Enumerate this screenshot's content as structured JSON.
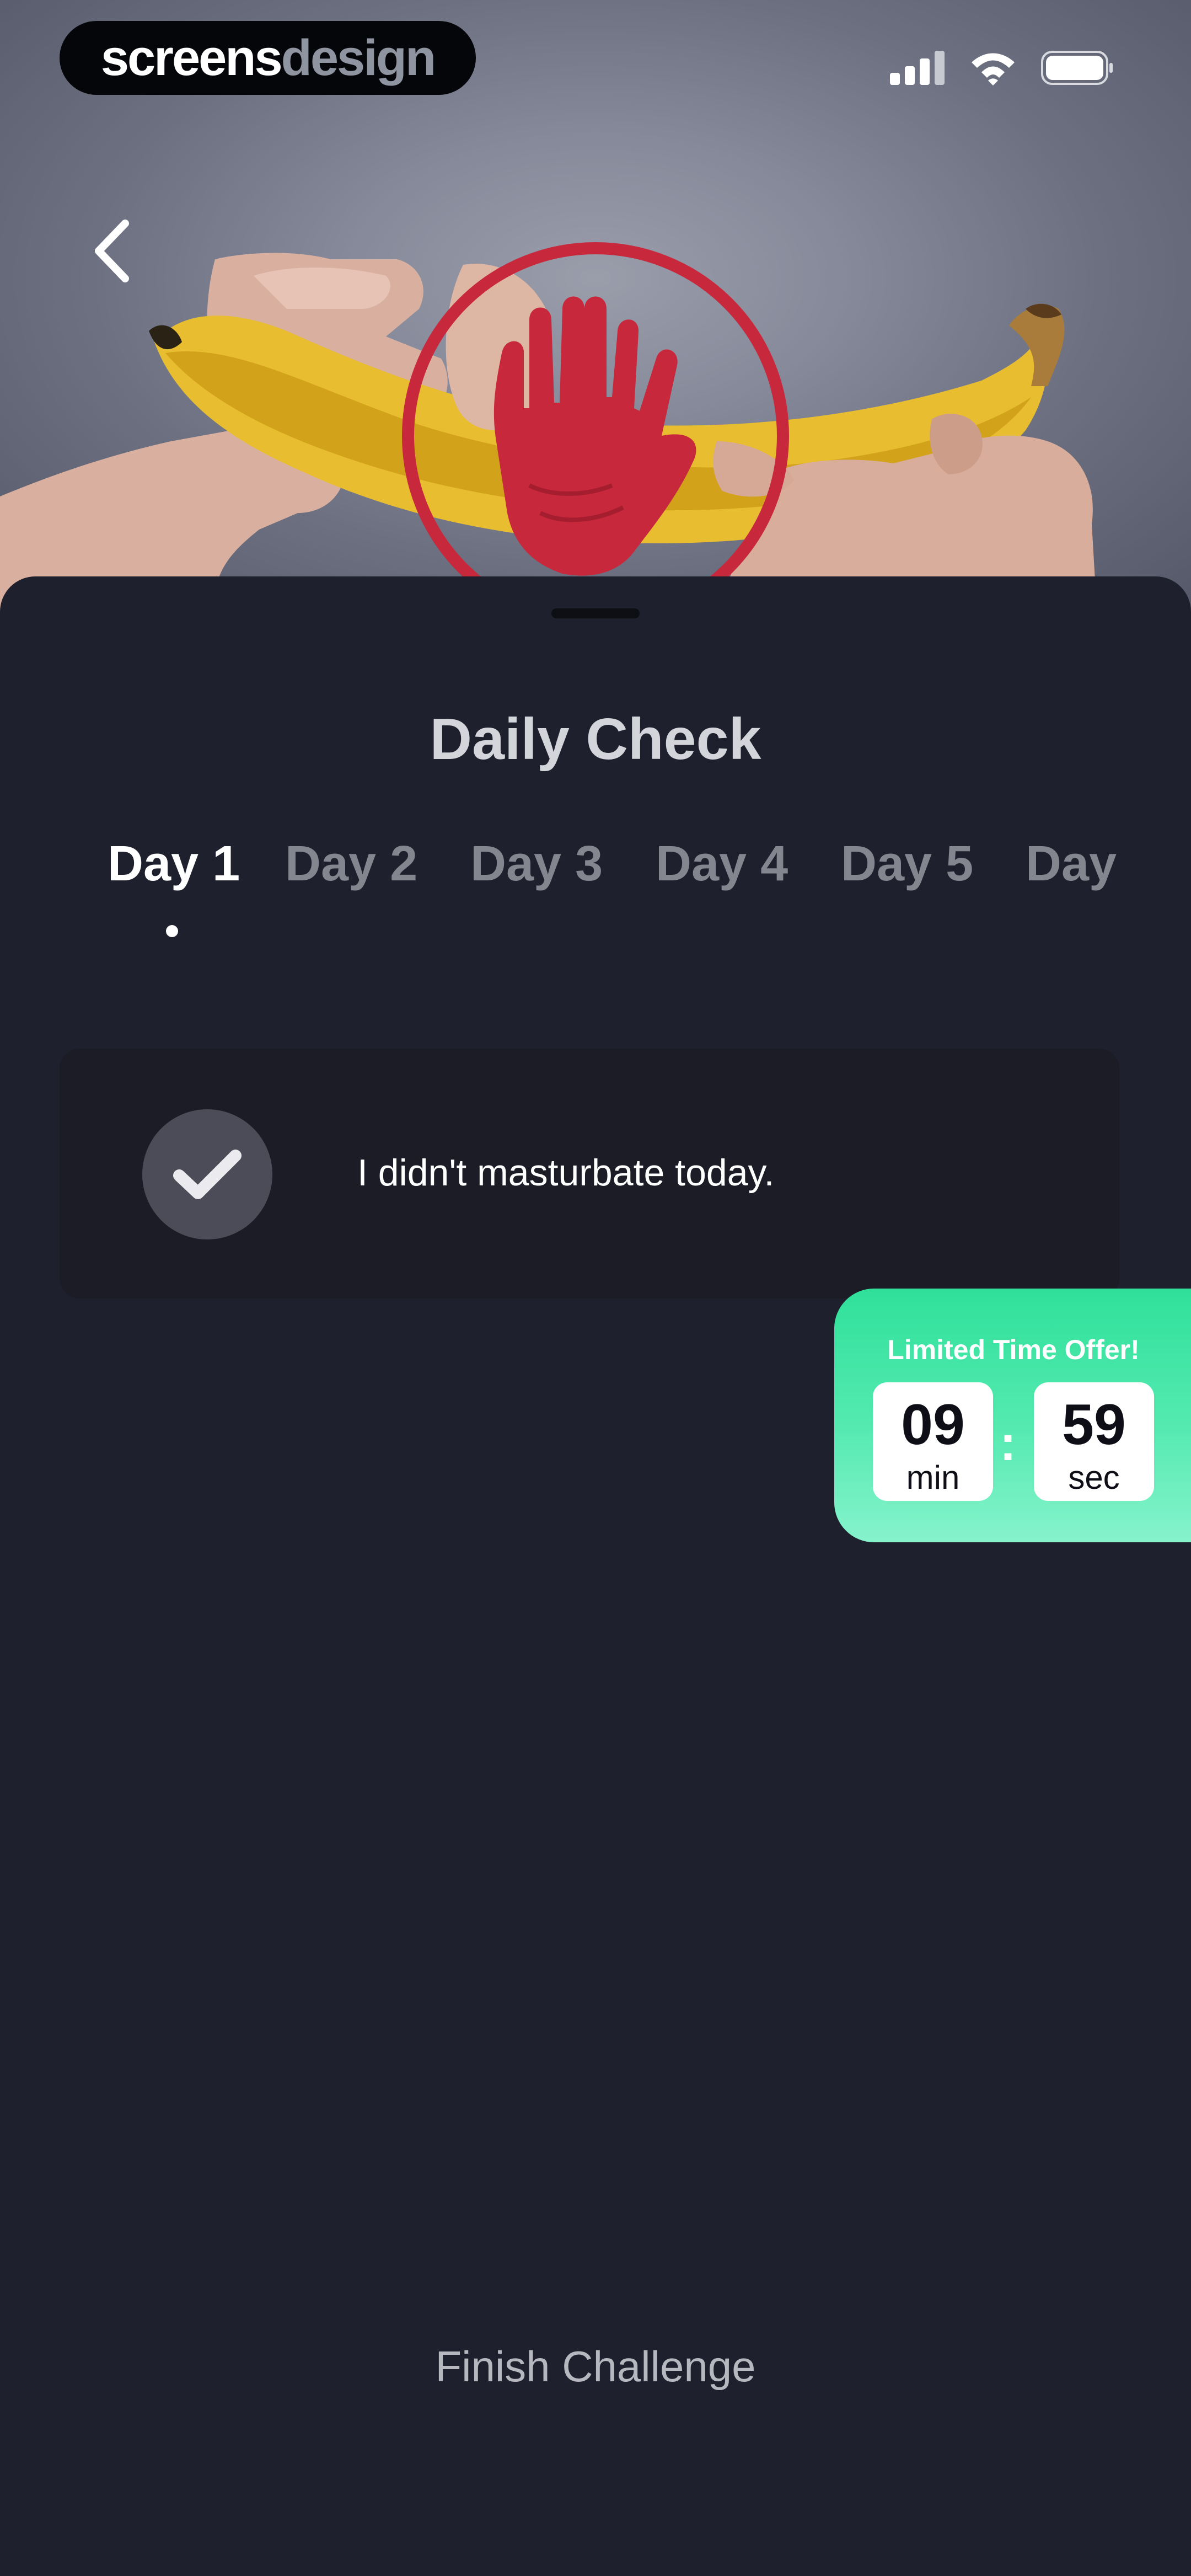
{
  "brand": {
    "part1": "screens",
    "part2": "design"
  },
  "status_bar": {
    "icons": [
      "cellular-signal-icon",
      "wifi-icon",
      "battery-icon"
    ]
  },
  "hero": {
    "image": "hand-stop-sign-over-banana"
  },
  "nav": {
    "back_icon": "chevron-left-icon"
  },
  "sheet": {
    "title": "Daily Check",
    "tabs": [
      {
        "label": "Day 1",
        "active": true
      },
      {
        "label": "Day 2",
        "active": false
      },
      {
        "label": "Day 3",
        "active": false
      },
      {
        "label": "Day 4",
        "active": false
      },
      {
        "label": "Day 5",
        "active": false
      },
      {
        "label": "Day",
        "active": false
      }
    ],
    "check_item": {
      "text": "I didn't masturbate today.",
      "icon": "checkmark-icon"
    },
    "finish_label": "Finish Challenge"
  },
  "offer": {
    "title": "Limited Time Offer!",
    "minutes": "09",
    "minutes_unit": "min",
    "seconds": "59",
    "seconds_unit": "sec",
    "separator": ":"
  },
  "colors": {
    "background": "#1f202d",
    "accent_green": "#2fe09a",
    "stop_red": "#c8283b"
  }
}
